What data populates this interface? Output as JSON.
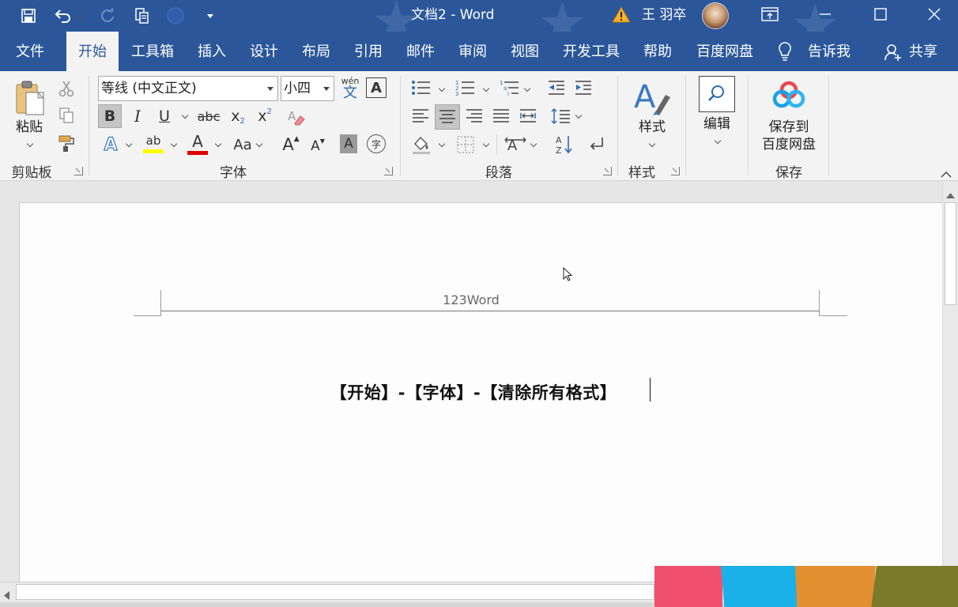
{
  "window": {
    "title": "文档2  -  Word",
    "user_name": "王 羽卒",
    "accent_color": "#2b579a"
  },
  "quick_access": {
    "icons": [
      "save-icon",
      "undo-icon",
      "redo-icon",
      "touch-mode-icon",
      "circle-shape-icon",
      "customize-qat-icon"
    ]
  },
  "tabs": [
    {
      "label": "文件"
    },
    {
      "label": "开始"
    },
    {
      "label": "工具箱"
    },
    {
      "label": "插入"
    },
    {
      "label": "设计"
    },
    {
      "label": "布局"
    },
    {
      "label": "引用"
    },
    {
      "label": "邮件"
    },
    {
      "label": "审阅"
    },
    {
      "label": "视图"
    },
    {
      "label": "开发工具"
    },
    {
      "label": "帮助"
    },
    {
      "label": "百度网盘"
    }
  ],
  "active_tab": "开始",
  "tell_me": "告诉我",
  "share": "共享",
  "ribbon": {
    "clipboard": {
      "paste_label": "粘贴",
      "group_label": "剪贴板"
    },
    "font": {
      "font_name": "等线 (中文正文)",
      "font_size": "小四",
      "group_label": "字体",
      "phonetic_label": "wén",
      "phonetic_char": "文",
      "bold": "B",
      "italic": "I",
      "underline": "U",
      "strike": "abc",
      "subscript": "x",
      "subscript_mark": "2",
      "superscript": "x",
      "superscript_mark": "2",
      "text_effect": "A",
      "highlight": "ab",
      "font_color": "A",
      "change_case": "Aa",
      "grow": "A",
      "shrink": "A",
      "char_shading": "A",
      "enclose_char": "字",
      "highlight_color": "#ffff00",
      "font_color_bar": "#e00000"
    },
    "paragraph": {
      "group_label": "段落"
    },
    "styles": {
      "label": "样式",
      "group_label": "样式"
    },
    "editing": {
      "label": "编辑"
    },
    "save": {
      "label_line1": "保存到",
      "label_line2": "百度网盘",
      "group_label": "保存"
    }
  },
  "document": {
    "header_text": "123Word",
    "body_text": "【开始】-【字体】-【清除所有格式】"
  },
  "overlay_colors": [
    "#f0506e",
    "#1ab0e8",
    "#e39130",
    "#7a7a2a"
  ]
}
